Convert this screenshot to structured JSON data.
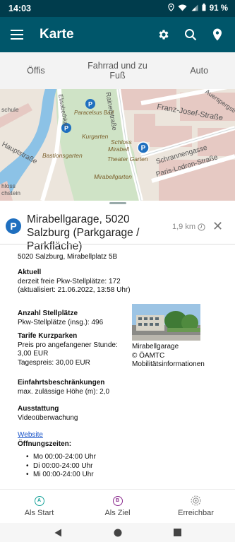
{
  "status": {
    "time": "14:03",
    "battery": "91 %"
  },
  "appbar": {
    "title": "Karte"
  },
  "modes": [
    {
      "label": "Öffis"
    },
    {
      "label": "Fahrrad und zu Fuß"
    },
    {
      "label": "Auto"
    }
  ],
  "map": {
    "labels": [
      "Franz-Josef-Straße",
      "Paracelsus Bad",
      "Kurgarten",
      "Schloss Mirabell",
      "Bastionsgarten",
      "Theater Garten",
      "Mirabellgarten",
      "Schrannengasse",
      "Paris-Lodron-Straße",
      "Elisabethkai",
      "Rainerstraße",
      "Auerspergstraße",
      "Hauptstraße",
      "schule",
      "hloss",
      "chstein"
    ]
  },
  "place": {
    "title": "Mirabellgarage, 5020 Salzburg (Parkgarage / Parkfläche)",
    "distance": "1,9 km"
  },
  "details": {
    "address": "5020 Salzburg, Mirabellplatz 5B",
    "current_heading": "Aktuell",
    "current_free": "derzeit freie Pkw-Stellplätze: 172",
    "current_updated": "(aktualisiert: 21.06.2022, 13:58 Uhr)",
    "spaces_heading": "Anzahl Stellplätze",
    "spaces_value": "Pkw-Stellplätze (insg.): 496",
    "tariff_heading": "Tarife Kurzparken",
    "tariff_hour_label": "Preis pro angefangener Stunde:",
    "tariff_hour_value": "3,00 EUR",
    "tariff_day": "Tagespreis: 30,00 EUR",
    "restrictions_heading": "Einfahrtsbeschränkungen",
    "restrictions_value": "max. zulässige Höhe (m): 2,0",
    "equipment_heading": "Ausstattung",
    "equipment_value": "Videoüberwachung",
    "website": "Website",
    "hours_heading": "Öffnungszeiten:",
    "hours": [
      "Mo 00:00-24:00 Uhr",
      "Di 00:00-24:00 Uhr",
      "Mi 00:00-24:00 Uhr"
    ],
    "photo_caption": [
      "Mirabellgarage",
      "© ÖAMTC Mobilitätsinformationen"
    ]
  },
  "actions": [
    {
      "label": "Als Start",
      "badge": "A",
      "color": "#1aa39a"
    },
    {
      "label": "Als Ziel",
      "badge": "B",
      "color": "#8a2b8e"
    },
    {
      "label": "Erreichbar",
      "badge": "",
      "color": "#888888"
    }
  ]
}
